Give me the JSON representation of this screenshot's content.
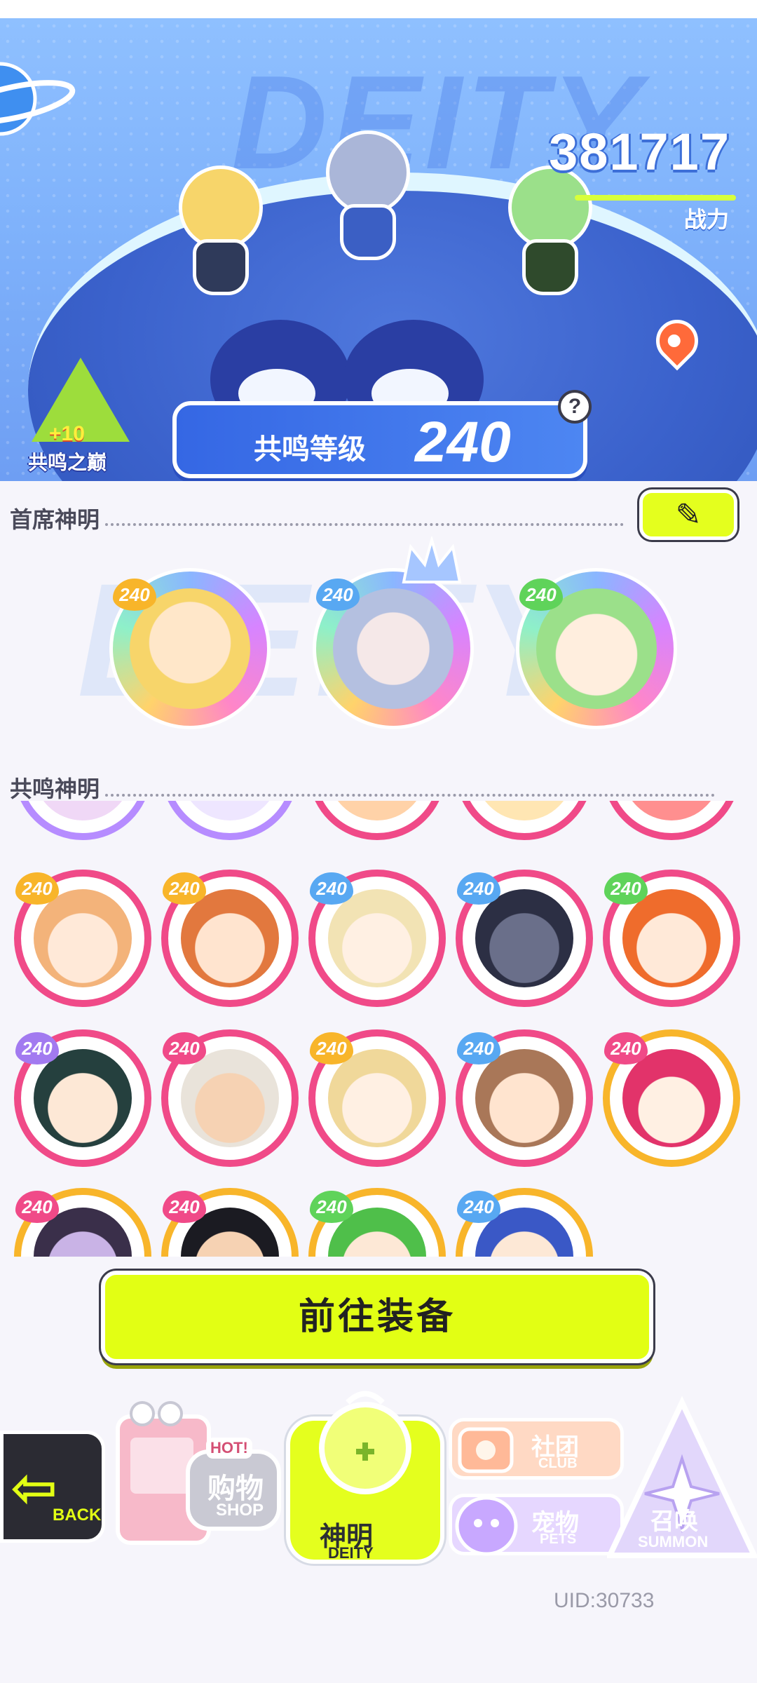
{
  "banner": {
    "bg_word": "DEITY",
    "power_value": "381717",
    "power_label": "战力",
    "peak_badge": {
      "plus": "+10",
      "label": "共鸣之巅"
    },
    "resonance": {
      "label": "共鸣等级",
      "value": "240"
    },
    "help_glyph": "?"
  },
  "sections": {
    "chief_title": "首席神明",
    "resonance_title": "共鸣神明",
    "watermark": "DEITY",
    "edit_icon": "✎"
  },
  "chief_deities": [
    {
      "level": "240"
    },
    {
      "level": "240"
    },
    {
      "level": "240"
    }
  ],
  "resonance_deities": {
    "level": "240"
  },
  "equip_button": "前往装备",
  "nav": {
    "back": {
      "label": "BACK",
      "icon": "left-arrow-icon"
    },
    "shop": {
      "cn": "购物",
      "en": "SHOP",
      "hot": "HOT!"
    },
    "deity": {
      "cn": "神明",
      "en": "DEITY"
    },
    "club": {
      "cn": "社团",
      "en": "CLUB"
    },
    "pets": {
      "cn": "宠物",
      "en": "PETS"
    },
    "summon": {
      "cn": "召唤",
      "en": "SUMMON"
    }
  },
  "uid": "UID:30733",
  "colors": {
    "accent_lime": "#e2ff14",
    "card_pink": "#f04a88",
    "card_gold": "#f8b52a",
    "banner_blue": "#7fb2fb"
  }
}
